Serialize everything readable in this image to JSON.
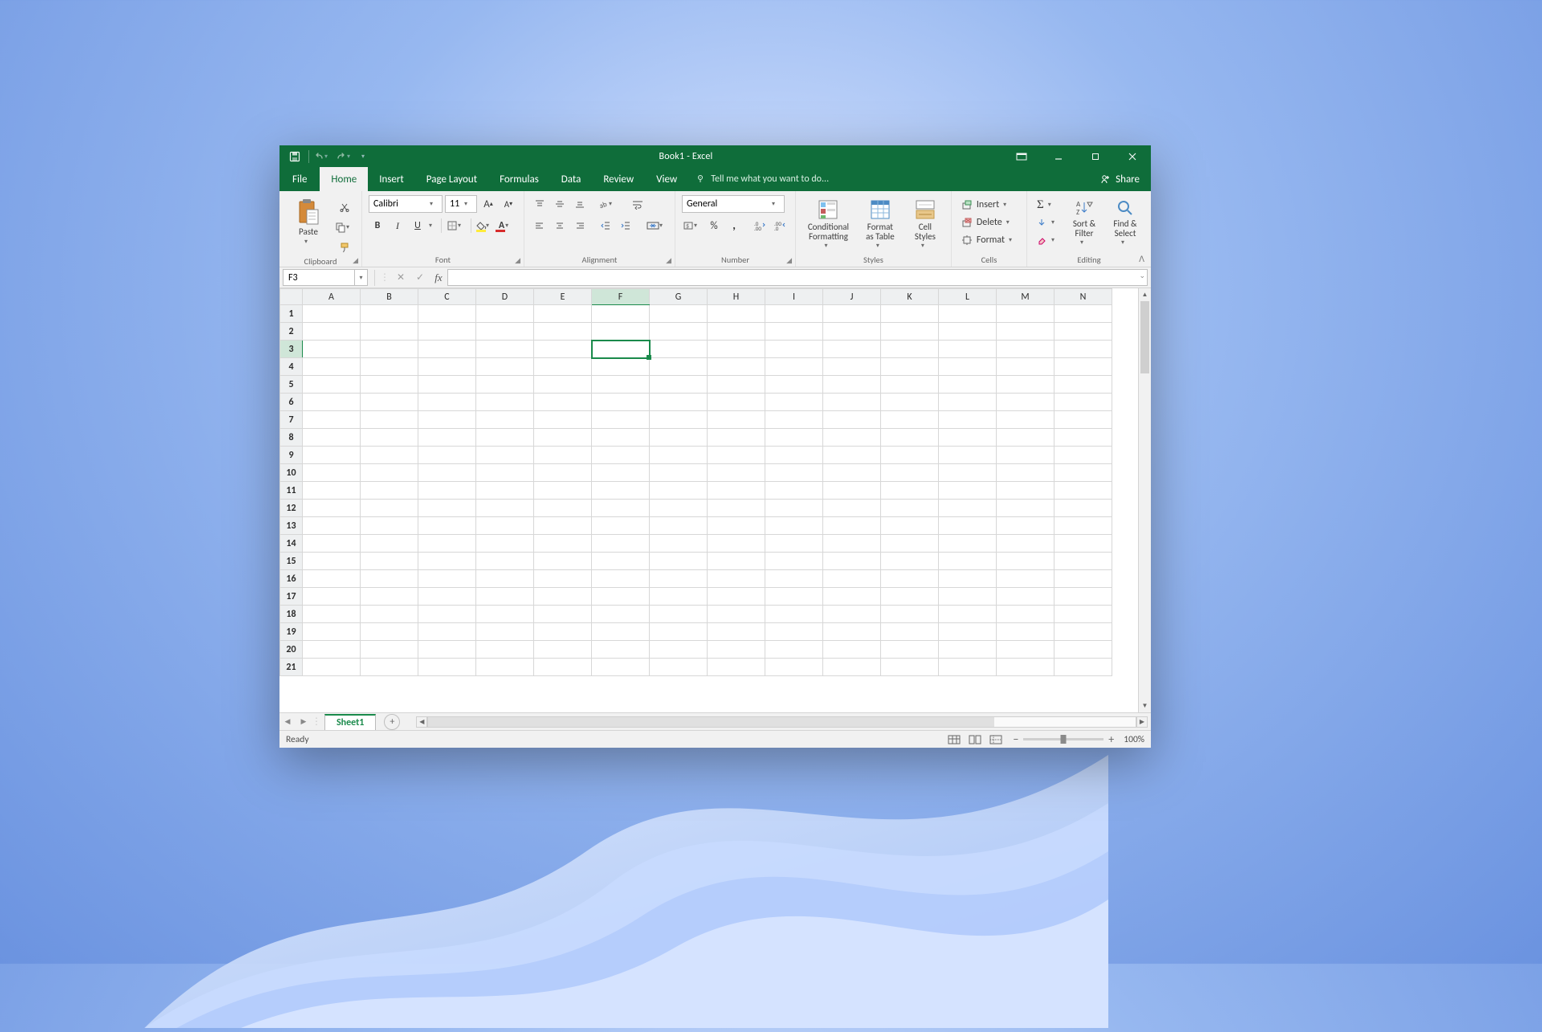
{
  "title": "Book1 - Excel",
  "qat": {
    "save": "save-icon",
    "undo": "undo-icon",
    "redo": "redo-icon"
  },
  "tabs": {
    "file": "File",
    "items": [
      "Home",
      "Insert",
      "Page Layout",
      "Formulas",
      "Data",
      "Review",
      "View"
    ],
    "active": "Home",
    "tell_me": "Tell me what you want to do...",
    "share": "Share"
  },
  "ribbon": {
    "clipboard": {
      "label": "Clipboard",
      "paste": "Paste"
    },
    "font": {
      "label": "Font",
      "name": "Calibri",
      "size": "11",
      "bold": "B",
      "italic": "I",
      "underline": "U"
    },
    "alignment": {
      "label": "Alignment"
    },
    "number": {
      "label": "Number",
      "format": "General"
    },
    "styles": {
      "label": "Styles",
      "cond": "Conditional Formatting",
      "table": "Format as Table",
      "cell": "Cell Styles"
    },
    "cells": {
      "label": "Cells",
      "insert": "Insert",
      "delete": "Delete",
      "format": "Format"
    },
    "editing": {
      "label": "Editing",
      "sort": "Sort & Filter",
      "find": "Find & Select"
    }
  },
  "formula_bar": {
    "name_box": "F3",
    "formula": ""
  },
  "grid": {
    "columns": [
      "A",
      "B",
      "C",
      "D",
      "E",
      "F",
      "G",
      "H",
      "I",
      "J",
      "K",
      "L",
      "M",
      "N"
    ],
    "rows": 21,
    "selected_cell": "F3",
    "selected_col": "F",
    "selected_row": 3
  },
  "sheets": {
    "active": "Sheet1"
  },
  "status": {
    "ready": "Ready",
    "zoom": "100%"
  }
}
